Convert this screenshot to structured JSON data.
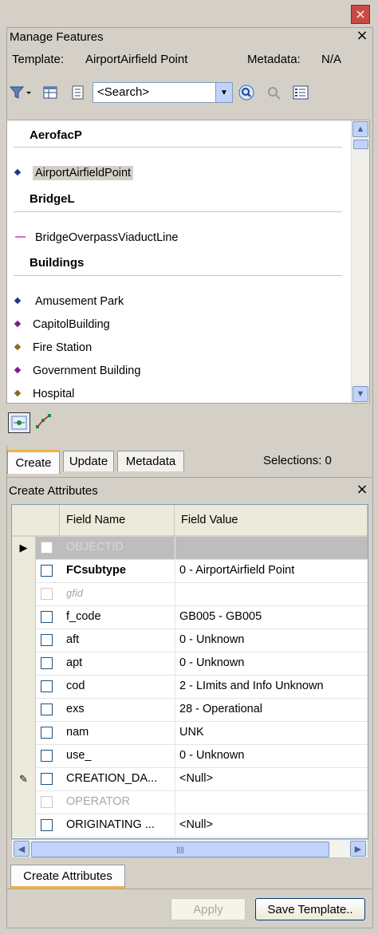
{
  "window": {
    "close_glyph": "×"
  },
  "manage": {
    "title": "Manage Features",
    "close_glyph": "×",
    "template_label": "Template:",
    "template_value": "AirportAirfield Point",
    "metadata_label": "Metadata:",
    "metadata_value": "N/A"
  },
  "toolbar": {
    "search_placeholder": "<Search>",
    "icons": [
      "filter-icon",
      "table-view-icon",
      "properties-icon",
      "search-go-icon",
      "locate-icon",
      "list-options-icon"
    ]
  },
  "templates": {
    "groups": [
      {
        "name": "AerofacP",
        "items": [
          {
            "label": "AirportAirfieldPoint",
            "color": "#1f3a8a",
            "selected": true
          }
        ]
      },
      {
        "name": "BridgeL",
        "items": [
          {
            "label": "BridgeOverpassViaductLine",
            "color": "#e26ac6",
            "line": true
          }
        ]
      },
      {
        "name": "Buildings",
        "items": [
          {
            "label": "Amusement Park",
            "color": "#1f3a8a"
          },
          {
            "label": "CapitolBuilding",
            "color": "#7a1e8a"
          },
          {
            "label": "Fire Station",
            "color": "#8a6a1e"
          },
          {
            "label": "Government Building",
            "color": "#7a1e8a"
          },
          {
            "label": "Hospital",
            "color": "#8a6a1e"
          }
        ]
      }
    ]
  },
  "bottom_tools": [
    "create-point-icon",
    "create-line-icon"
  ],
  "tabs": {
    "create": "Create",
    "update": "Update",
    "metadata": "Metadata"
  },
  "selections": "Selections: 0",
  "attributes": {
    "title": "Create Attributes",
    "close_glyph": "×",
    "col_name": "Field Name",
    "col_value": "Field Value",
    "rows": [
      {
        "name": "OBJECTID",
        "value": "",
        "style": "disabled-highlight",
        "marker": "▶"
      },
      {
        "name": "FCsubtype",
        "value": "0 - AirportAirfield Point",
        "style": "bold"
      },
      {
        "name": "gfid",
        "value": "",
        "style": "disabled-italic"
      },
      {
        "name": "f_code",
        "value": "GB005 - GB005"
      },
      {
        "name": "aft",
        "value": "0 - Unknown"
      },
      {
        "name": "apt",
        "value": "0 - Unknown"
      },
      {
        "name": "cod",
        "value": "2 - LImits and Info Unknown"
      },
      {
        "name": "exs",
        "value": "28 - Operational"
      },
      {
        "name": "nam",
        "value": "UNK"
      },
      {
        "name": "use_",
        "value": "0 - Unknown"
      },
      {
        "name": "CREATION_DA...",
        "value": "<Null>",
        "marker": "✎"
      },
      {
        "name": "OPERATOR",
        "value": "",
        "style": "disabled"
      },
      {
        "name": "ORIGINATING ...",
        "value": "<Null>"
      }
    ],
    "tab_label": "Create Attributes"
  },
  "buttons": {
    "apply": "Apply",
    "save_template": "Save Template.."
  }
}
